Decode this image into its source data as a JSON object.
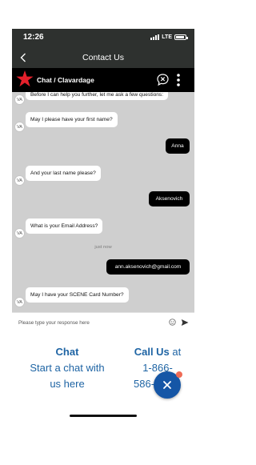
{
  "status_bar": {
    "time": "12:26",
    "network": "LTE",
    "battery_level": 0.9
  },
  "nav": {
    "title": "Contact Us"
  },
  "chat_header": {
    "title": "Chat / Clavardage",
    "brand_color": "#e4202b"
  },
  "messages": [
    {
      "sender": "agent",
      "avatar": "VA",
      "text": "Before I can help you further, let me ask a few questions:"
    },
    {
      "sender": "agent",
      "avatar": "VA",
      "text": "May I please have your first name?"
    },
    {
      "sender": "user",
      "text": "Anna"
    },
    {
      "sender": "agent",
      "avatar": "VA",
      "text": "And your last name please?"
    },
    {
      "sender": "user",
      "text": "Aksenovich"
    },
    {
      "sender": "agent",
      "avatar": "VA",
      "text": "What is your Email Address?"
    },
    {
      "sender": "user",
      "text": "ann.aksenovich@gmail.com"
    },
    {
      "sender": "agent",
      "avatar": "VA",
      "text": "May I have your SCENE Card Number?"
    }
  ],
  "timestamp": "just now",
  "composer": {
    "placeholder": "Please type your response here"
  },
  "contact_options": {
    "chat": {
      "heading": "Chat",
      "line1": "Start a chat with",
      "line2": "us here"
    },
    "call": {
      "heading": "Call Us",
      "suffix": "at",
      "line1": "1-866-",
      "line2": "586-2"
    }
  },
  "colors": {
    "header_bg": "#2e312f",
    "chat_bg": "#cfcfcf",
    "link": "#1e64a4",
    "fab": "#1556a6",
    "badge": "#ef6b56"
  }
}
